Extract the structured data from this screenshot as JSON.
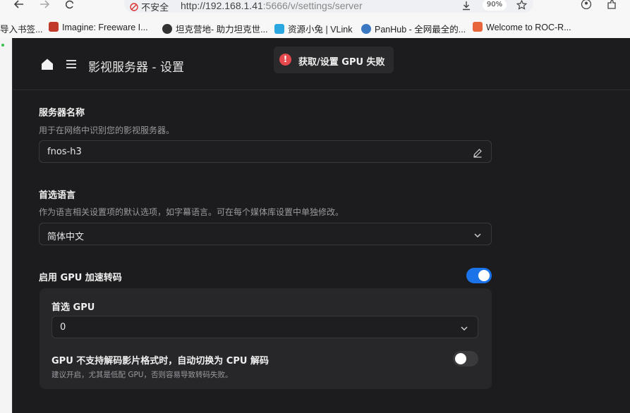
{
  "browser": {
    "secure_label": "不安全",
    "url_host": "http://192.168.1.41",
    "url_rest": ":5666/v/settings/server",
    "zoom": "90%",
    "bookmarks": [
      {
        "label": "导入书签...",
        "color": "#f7f7f7"
      },
      {
        "label": "Imagine: Freeware I...",
        "color": "#c0392b"
      },
      {
        "label": "坦克营地- 助力坦克世...",
        "color": "#333333"
      },
      {
        "label": "资源小兔 | VLink",
        "color": "#2aa7e0"
      },
      {
        "label": "PanHub - 全网最全的...",
        "color": "#3a78c2"
      },
      {
        "label": "Welcome to ROC-R...",
        "color": "#e8643a"
      }
    ]
  },
  "header": {
    "title": "影视服务器 - 设置"
  },
  "toast": {
    "icon": "!",
    "message": "获取/设置 GPU 失败"
  },
  "server_name": {
    "label": "服务器名称",
    "description": "用于在网络中识别您的影视服务器。",
    "value": "fnos-h3"
  },
  "language": {
    "label": "首选语言",
    "description": "作为语言相关设置项的默认选项，如字幕语言。可在每个媒体库设置中单独修改。",
    "selected": "简体中文"
  },
  "gpu": {
    "label": "启用 GPU 加速转码",
    "enabled": true,
    "preferred_label": "首选 GPU",
    "preferred_value": "0",
    "fallback_label": "GPU 不支持解码影片格式时，自动切换为 CPU 解码",
    "fallback_description": "建议开启，尤其是低配 GPU，否则容易导致转码失败。",
    "fallback_enabled": false
  },
  "colors": {
    "accent": "#1a73e8",
    "toggle_off": "#3a3a3d",
    "error": "#e5484d"
  }
}
